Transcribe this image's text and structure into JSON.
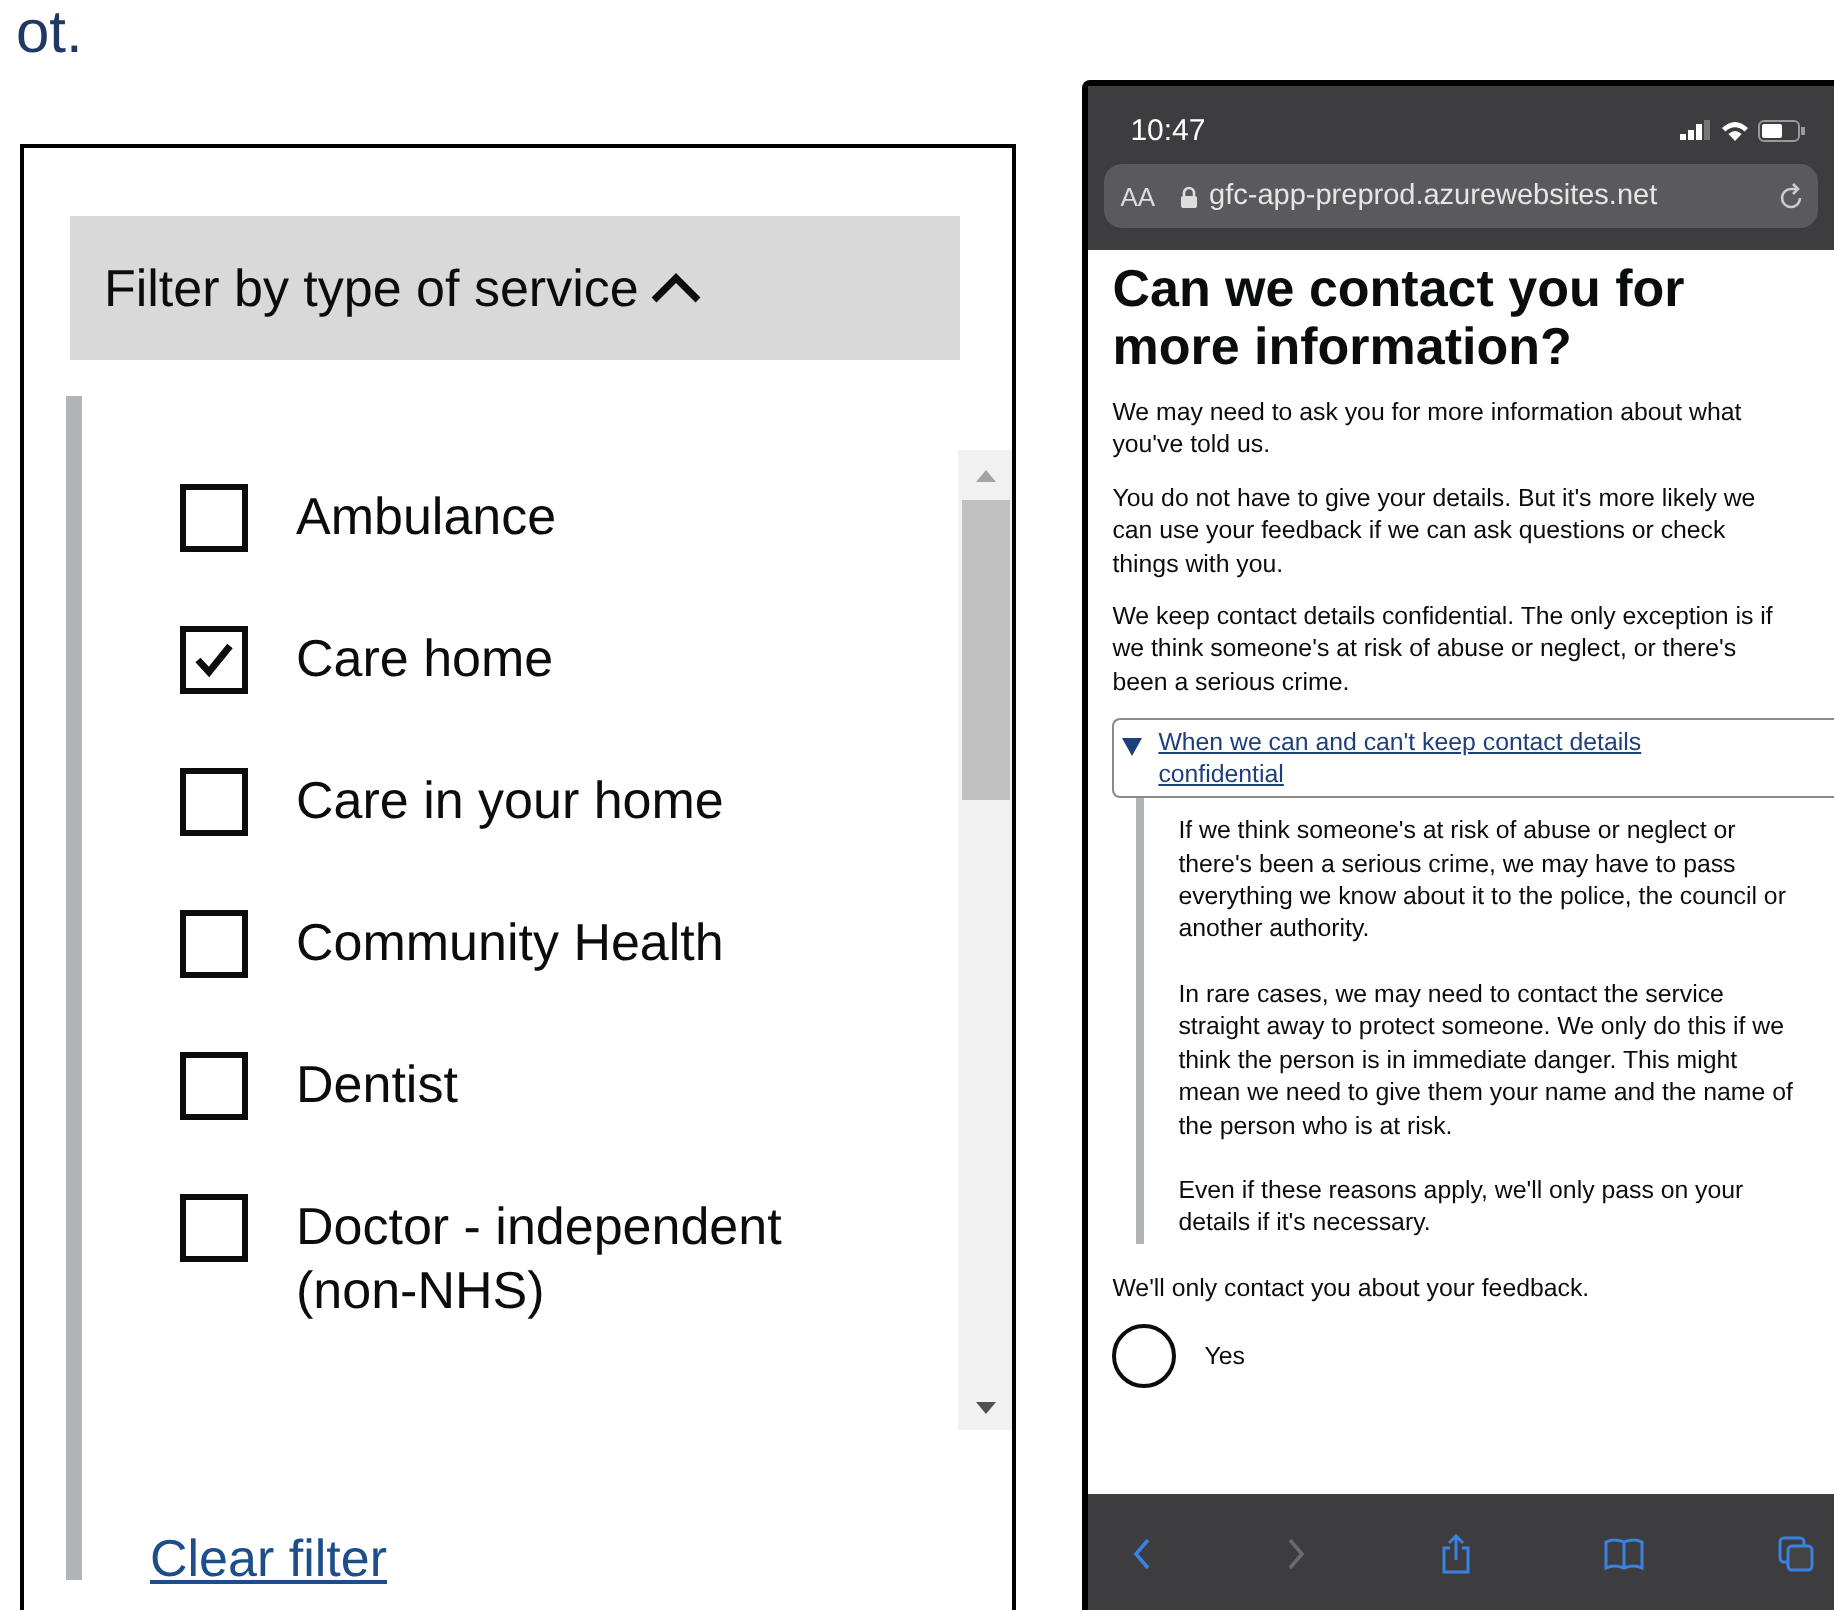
{
  "caption": "ot.",
  "filter": {
    "title": "Filter by type of service",
    "expanded": true,
    "options": [
      {
        "label": "Ambulance",
        "checked": false
      },
      {
        "label": "Care home",
        "checked": true
      },
      {
        "label": "Care in your home",
        "checked": false
      },
      {
        "label": "Community Health",
        "checked": false
      },
      {
        "label": "Dentist",
        "checked": false
      },
      {
        "label": "Doctor - independent (non-NHS)",
        "checked": false
      }
    ],
    "clear_link": "Clear filter"
  },
  "phone": {
    "status_bar": {
      "time": "10:47"
    },
    "address_bar": {
      "text_size_button": "AA",
      "url": "gfc-app-preprod.azurewebsites.net"
    },
    "page": {
      "heading": "Can we contact you for more information?",
      "paragraphs": [
        "We may need to ask you for more information about what you've told us.",
        "You do not have to give your details. But it's more likely we can use your feedback if we can ask questions or check things with you.",
        "We keep contact details confidential. The only exception is if we think someone's at risk of abuse or neglect, or there's been a serious crime."
      ],
      "details": {
        "summary": "When we can and can't keep contact details confidential",
        "expanded": true,
        "paragraphs": [
          "If we think someone's at risk of abuse or neglect or there's been a serious crime, we may have to pass everything we know about it to the police, the council or another authority.",
          "In rare cases, we may need to contact the service straight away to protect someone. We only do this if we think the person is in immediate danger. This might mean we need to give them your name and the name of the person who is at risk.",
          "Even if these reasons apply, we'll only pass on your details if it's necessary."
        ]
      },
      "note": "We'll only contact you about your feedback.",
      "radios": [
        {
          "label": "Yes",
          "selected": false
        }
      ]
    },
    "toolbar": {
      "back_disabled": false,
      "forward_disabled": true
    }
  }
}
